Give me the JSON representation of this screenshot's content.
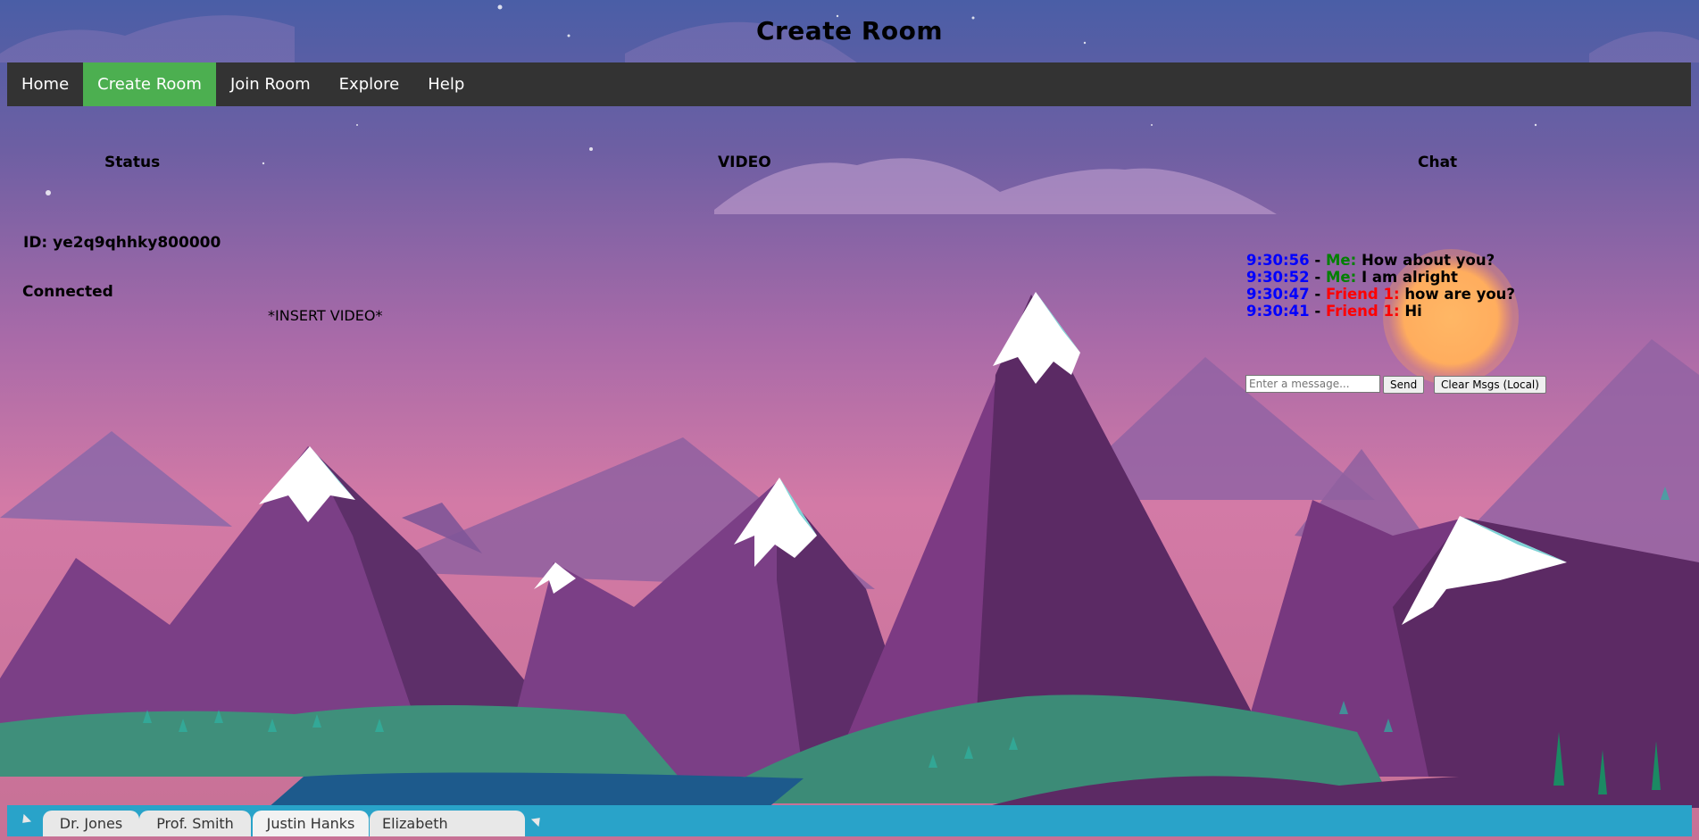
{
  "page": {
    "title": "Create Room"
  },
  "nav": {
    "items": [
      {
        "label": "Home",
        "active": false
      },
      {
        "label": "Create Room",
        "active": true
      },
      {
        "label": "Join Room",
        "active": false
      },
      {
        "label": "Explore",
        "active": false
      },
      {
        "label": "Help",
        "active": false
      }
    ]
  },
  "status": {
    "heading": "Status",
    "id_line": "ID: ye2q9qhhky800000",
    "connection": "Connected"
  },
  "video": {
    "heading": "VIDEO",
    "placeholder": "*INSERT VIDEO*"
  },
  "chat": {
    "heading": "Chat",
    "messages": [
      {
        "time": "9:30:56",
        "sender": "Me:",
        "sender_kind": "me",
        "text": "How about you?"
      },
      {
        "time": "9:30:52",
        "sender": "Me:",
        "sender_kind": "me",
        "text": "I am alright"
      },
      {
        "time": "9:30:47",
        "sender": "Friend 1:",
        "sender_kind": "friend",
        "text": "how are you?"
      },
      {
        "time": "9:30:41",
        "sender": "Friend 1:",
        "sender_kind": "friend",
        "text": "Hi"
      }
    ],
    "separator": "-",
    "input_placeholder": "Enter a message...",
    "send_label": "Send",
    "clear_label": "Clear Msgs (Local)"
  },
  "taskbar": {
    "tabs": [
      {
        "label": "Dr. Jones"
      },
      {
        "label": "Prof. Smith"
      },
      {
        "label": "Justin Hanks"
      },
      {
        "label": "Elizabeth"
      }
    ]
  },
  "colors": {
    "nav_bg": "#333333",
    "nav_active": "#4caf50",
    "chat_time": "#0000ff",
    "chat_me": "#008000",
    "chat_friend": "#ff0000",
    "taskbar": "#29a3c9"
  }
}
